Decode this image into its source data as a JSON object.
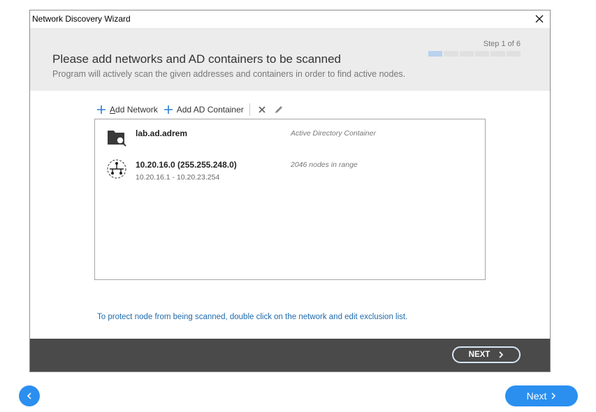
{
  "window": {
    "title": "Network Discovery Wizard",
    "close_icon": "close-icon"
  },
  "header": {
    "heading": "Please add networks and AD containers to be scanned",
    "subheading": "Program will actively scan the given addresses and containers in order to find active nodes.",
    "step_label": "Step 1 of 6",
    "step_current": 1,
    "step_total": 6
  },
  "toolbar": {
    "add_network": "Add Network",
    "add_ad_container": "Add AD Container",
    "delete_icon": "delete-icon",
    "edit_icon": "pencil-icon"
  },
  "list": {
    "items": [
      {
        "icon": "ad-container-icon",
        "name": "lab.ad.adrem",
        "sub": "",
        "desc": "Active Directory Container"
      },
      {
        "icon": "network-icon",
        "name": "10.20.16.0  (255.255.248.0)",
        "sub": "10.20.16.1 - 10.20.23.254",
        "desc": "2046 nodes in range"
      }
    ]
  },
  "hint": "To protect node from being scanned, double click on the network and edit exclusion list.",
  "footer": {
    "next_label": "NEXT"
  },
  "nav": {
    "back_icon": "chevron-left-icon",
    "next_label": "Next"
  },
  "colors": {
    "accent": "#2b8ff0",
    "footer_bg": "#4a4a4a",
    "header_bg": "#ececec",
    "link": "#1f6aab",
    "progress_on": "#b9d2ef",
    "plus_blue": "#2a7fd4"
  }
}
